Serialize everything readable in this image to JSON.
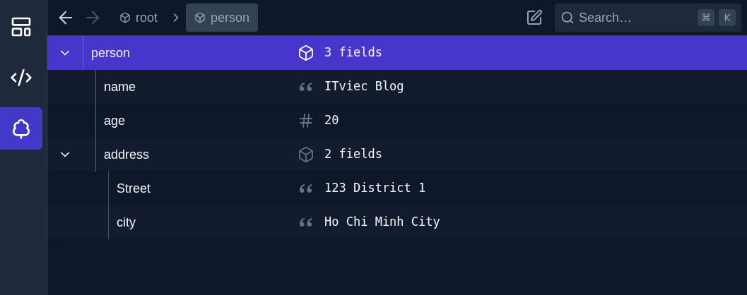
{
  "sidebar": {
    "items": [
      {
        "kind": "layout",
        "selected": false
      },
      {
        "kind": "code",
        "selected": false
      },
      {
        "kind": "tree",
        "selected": true
      }
    ]
  },
  "toolbar": {
    "back_enabled": true,
    "forward_enabled": false,
    "breadcrumbs": [
      {
        "label": "root",
        "selected": false
      },
      {
        "label": "person",
        "selected": true
      }
    ],
    "search": {
      "placeholder": "Search…",
      "keys": [
        "⌘",
        "K"
      ]
    }
  },
  "tree": [
    {
      "name": "person",
      "kind": "object",
      "value": "3 fields",
      "selected": true,
      "expanded": true,
      "children": [
        {
          "name": "name",
          "kind": "string",
          "value": "ITviec Blog",
          "selected": false
        },
        {
          "name": "age",
          "kind": "number",
          "value": "20",
          "selected": false
        },
        {
          "name": "address",
          "kind": "object",
          "value": "2 fields",
          "selected": false,
          "expanded": true,
          "children": [
            {
              "name": "Street",
              "kind": "string",
              "value": "123 District 1",
              "selected": false
            },
            {
              "name": "city",
              "kind": "string",
              "value": "Ho Chi Minh City",
              "selected": false
            }
          ]
        }
      ]
    }
  ]
}
